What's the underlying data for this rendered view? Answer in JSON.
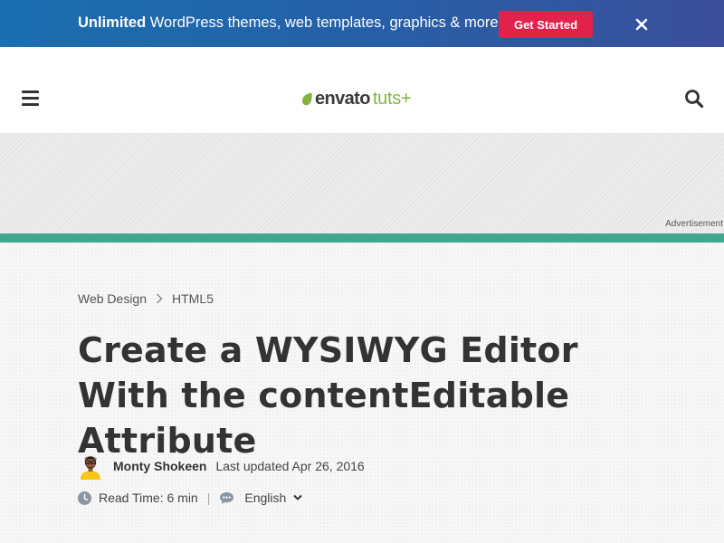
{
  "promo": {
    "highlight": "Unlimited",
    "text": " WordPress themes, web templates, graphics & more!",
    "button_label": "Get Started"
  },
  "header": {
    "logo_primary": "envato",
    "logo_secondary": "tuts+"
  },
  "ad": {
    "label": "Advertisement"
  },
  "breadcrumb": {
    "items": [
      "Web Design",
      "HTML5"
    ]
  },
  "article": {
    "title": "Create a WYSIWYG Editor With the contentEditable Attribute",
    "author": "Monty Shokeen",
    "updated": "Last updated Apr 26, 2016",
    "read_time": "Read Time: 6 min",
    "separator": "|",
    "language": "English"
  },
  "colors": {
    "promo_button": "#e2224b",
    "accent_green": "#40a68c",
    "logo_green": "#82b541"
  },
  "icons": [
    "close-icon",
    "hamburger-menu-icon",
    "envato-leaf-icon",
    "search-icon",
    "chevron-right-icon",
    "clock-icon",
    "chat-icon",
    "chevron-down-icon"
  ]
}
